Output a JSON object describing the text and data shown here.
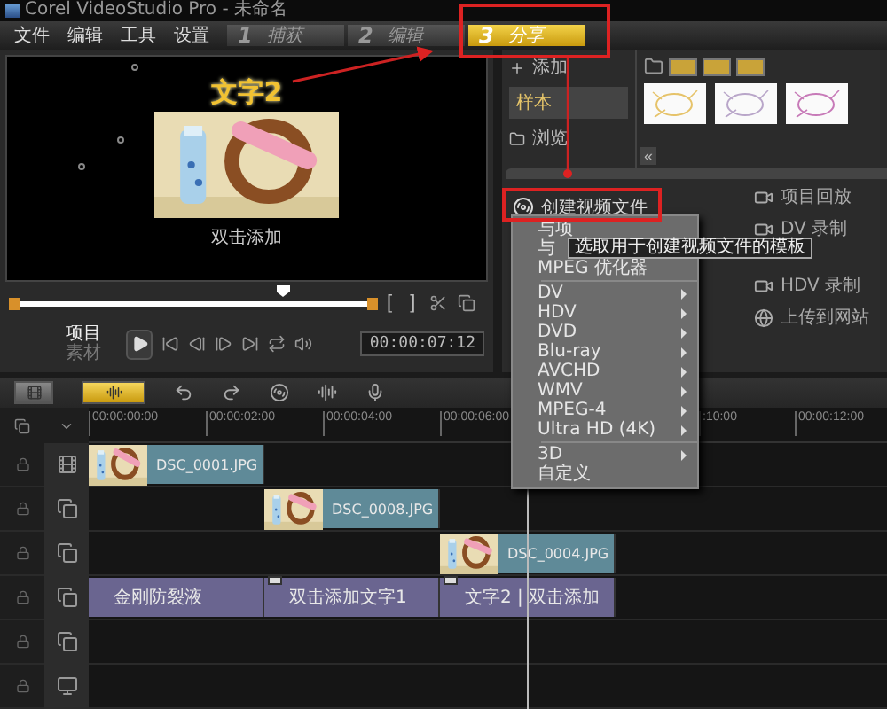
{
  "window": {
    "title": "Corel VideoStudio Pro - 未命名"
  },
  "menu": [
    "文件",
    "编辑",
    "工具",
    "设置"
  ],
  "steps": [
    {
      "number": "1",
      "label": "捕获",
      "selected": false
    },
    {
      "number": "2",
      "label": "编辑",
      "selected": false
    },
    {
      "number": "3",
      "label": "分享",
      "selected": true
    }
  ],
  "preview": {
    "title_text": "文字2",
    "caption": "双击添加",
    "scrubber": {
      "level": 0.75
    },
    "trim_start": "[",
    "trim_end": "]",
    "modes": [
      {
        "label": "项目",
        "selected": true
      },
      {
        "label": "素材",
        "selected": false
      }
    ],
    "timecode": "00:00:07:12"
  },
  "library": {
    "add": "添加",
    "categories": [
      {
        "label": "样本",
        "selected": true
      }
    ],
    "browse": "浏览",
    "collapse": "«"
  },
  "share": {
    "create": "创建视频文件",
    "outputs": [
      "项目回放",
      "DV 录制",
      "HDV 录制",
      "上传到网站"
    ]
  },
  "context_menu": [
    {
      "kind": "item",
      "label": "与项",
      "submenu": false
    },
    {
      "kind": "item",
      "label": "与",
      "submenu": false
    },
    {
      "kind": "item",
      "label": "MPEG 优化器",
      "submenu": false
    },
    {
      "kind": "separator"
    },
    {
      "kind": "item",
      "label": "DV",
      "submenu": true
    },
    {
      "kind": "item",
      "label": "HDV",
      "submenu": true
    },
    {
      "kind": "item",
      "label": "DVD",
      "submenu": true
    },
    {
      "kind": "item",
      "label": "Blu-ray",
      "submenu": true
    },
    {
      "kind": "item",
      "label": "AVCHD",
      "submenu": true
    },
    {
      "kind": "item",
      "label": "WMV",
      "submenu": true
    },
    {
      "kind": "item",
      "label": "MPEG-4",
      "submenu": true
    },
    {
      "kind": "item",
      "label": "Ultra HD (4K)",
      "submenu": true
    },
    {
      "kind": "separator"
    },
    {
      "kind": "item",
      "label": "3D",
      "submenu": true
    },
    {
      "kind": "item",
      "label": "自定义",
      "submenu": false
    }
  ],
  "tooltip": "选取用于创建视频文件的模板",
  "timeline": {
    "ruler": [
      "00:00:00:00",
      "00:00:02:00",
      "00:00:04:00",
      "00:00:06:00",
      ":10:00",
      "00:00:12:00"
    ],
    "tracks": [
      {
        "kind": "video",
        "clips": [
          {
            "label": "DSC_0001.JPG"
          }
        ]
      },
      {
        "kind": "overlay",
        "clips": [
          {
            "label": "DSC_0008.JPG"
          }
        ]
      },
      {
        "kind": "overlay",
        "clips": [
          {
            "label": "DSC_0004.JPG"
          }
        ]
      },
      {
        "kind": "overlay",
        "clips": [
          {
            "kind": "text",
            "label": "金刚防裂液"
          },
          {
            "kind": "text",
            "label": "双击添加文字1"
          },
          {
            "kind": "text",
            "label": "文字2 | 双击添加"
          }
        ]
      },
      {
        "kind": "overlay"
      },
      {
        "kind": "title"
      }
    ]
  }
}
